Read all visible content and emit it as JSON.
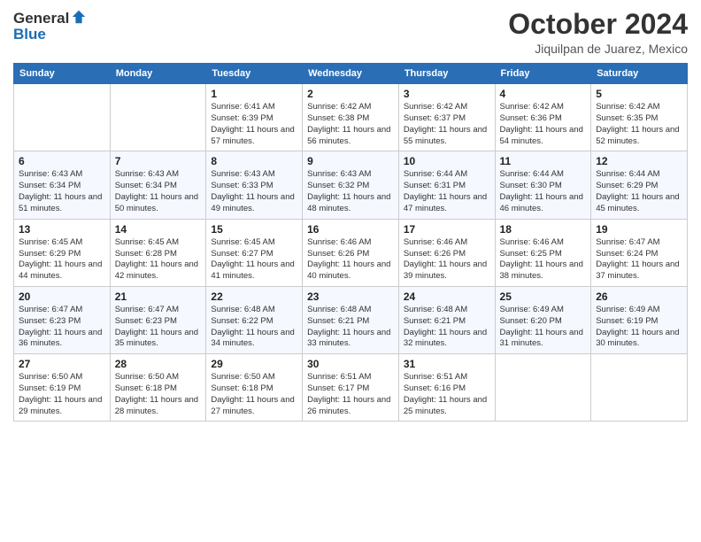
{
  "header": {
    "logo_general": "General",
    "logo_blue": "Blue",
    "title": "October 2024",
    "location": "Jiquilpan de Juarez, Mexico"
  },
  "days_of_week": [
    "Sunday",
    "Monday",
    "Tuesday",
    "Wednesday",
    "Thursday",
    "Friday",
    "Saturday"
  ],
  "weeks": [
    [
      {
        "day": "",
        "sunrise": "",
        "sunset": "",
        "daylight": ""
      },
      {
        "day": "",
        "sunrise": "",
        "sunset": "",
        "daylight": ""
      },
      {
        "day": "1",
        "sunrise": "Sunrise: 6:41 AM",
        "sunset": "Sunset: 6:39 PM",
        "daylight": "Daylight: 11 hours and 57 minutes."
      },
      {
        "day": "2",
        "sunrise": "Sunrise: 6:42 AM",
        "sunset": "Sunset: 6:38 PM",
        "daylight": "Daylight: 11 hours and 56 minutes."
      },
      {
        "day": "3",
        "sunrise": "Sunrise: 6:42 AM",
        "sunset": "Sunset: 6:37 PM",
        "daylight": "Daylight: 11 hours and 55 minutes."
      },
      {
        "day": "4",
        "sunrise": "Sunrise: 6:42 AM",
        "sunset": "Sunset: 6:36 PM",
        "daylight": "Daylight: 11 hours and 54 minutes."
      },
      {
        "day": "5",
        "sunrise": "Sunrise: 6:42 AM",
        "sunset": "Sunset: 6:35 PM",
        "daylight": "Daylight: 11 hours and 52 minutes."
      }
    ],
    [
      {
        "day": "6",
        "sunrise": "Sunrise: 6:43 AM",
        "sunset": "Sunset: 6:34 PM",
        "daylight": "Daylight: 11 hours and 51 minutes."
      },
      {
        "day": "7",
        "sunrise": "Sunrise: 6:43 AM",
        "sunset": "Sunset: 6:34 PM",
        "daylight": "Daylight: 11 hours and 50 minutes."
      },
      {
        "day": "8",
        "sunrise": "Sunrise: 6:43 AM",
        "sunset": "Sunset: 6:33 PM",
        "daylight": "Daylight: 11 hours and 49 minutes."
      },
      {
        "day": "9",
        "sunrise": "Sunrise: 6:43 AM",
        "sunset": "Sunset: 6:32 PM",
        "daylight": "Daylight: 11 hours and 48 minutes."
      },
      {
        "day": "10",
        "sunrise": "Sunrise: 6:44 AM",
        "sunset": "Sunset: 6:31 PM",
        "daylight": "Daylight: 11 hours and 47 minutes."
      },
      {
        "day": "11",
        "sunrise": "Sunrise: 6:44 AM",
        "sunset": "Sunset: 6:30 PM",
        "daylight": "Daylight: 11 hours and 46 minutes."
      },
      {
        "day": "12",
        "sunrise": "Sunrise: 6:44 AM",
        "sunset": "Sunset: 6:29 PM",
        "daylight": "Daylight: 11 hours and 45 minutes."
      }
    ],
    [
      {
        "day": "13",
        "sunrise": "Sunrise: 6:45 AM",
        "sunset": "Sunset: 6:29 PM",
        "daylight": "Daylight: 11 hours and 44 minutes."
      },
      {
        "day": "14",
        "sunrise": "Sunrise: 6:45 AM",
        "sunset": "Sunset: 6:28 PM",
        "daylight": "Daylight: 11 hours and 42 minutes."
      },
      {
        "day": "15",
        "sunrise": "Sunrise: 6:45 AM",
        "sunset": "Sunset: 6:27 PM",
        "daylight": "Daylight: 11 hours and 41 minutes."
      },
      {
        "day": "16",
        "sunrise": "Sunrise: 6:46 AM",
        "sunset": "Sunset: 6:26 PM",
        "daylight": "Daylight: 11 hours and 40 minutes."
      },
      {
        "day": "17",
        "sunrise": "Sunrise: 6:46 AM",
        "sunset": "Sunset: 6:26 PM",
        "daylight": "Daylight: 11 hours and 39 minutes."
      },
      {
        "day": "18",
        "sunrise": "Sunrise: 6:46 AM",
        "sunset": "Sunset: 6:25 PM",
        "daylight": "Daylight: 11 hours and 38 minutes."
      },
      {
        "day": "19",
        "sunrise": "Sunrise: 6:47 AM",
        "sunset": "Sunset: 6:24 PM",
        "daylight": "Daylight: 11 hours and 37 minutes."
      }
    ],
    [
      {
        "day": "20",
        "sunrise": "Sunrise: 6:47 AM",
        "sunset": "Sunset: 6:23 PM",
        "daylight": "Daylight: 11 hours and 36 minutes."
      },
      {
        "day": "21",
        "sunrise": "Sunrise: 6:47 AM",
        "sunset": "Sunset: 6:23 PM",
        "daylight": "Daylight: 11 hours and 35 minutes."
      },
      {
        "day": "22",
        "sunrise": "Sunrise: 6:48 AM",
        "sunset": "Sunset: 6:22 PM",
        "daylight": "Daylight: 11 hours and 34 minutes."
      },
      {
        "day": "23",
        "sunrise": "Sunrise: 6:48 AM",
        "sunset": "Sunset: 6:21 PM",
        "daylight": "Daylight: 11 hours and 33 minutes."
      },
      {
        "day": "24",
        "sunrise": "Sunrise: 6:48 AM",
        "sunset": "Sunset: 6:21 PM",
        "daylight": "Daylight: 11 hours and 32 minutes."
      },
      {
        "day": "25",
        "sunrise": "Sunrise: 6:49 AM",
        "sunset": "Sunset: 6:20 PM",
        "daylight": "Daylight: 11 hours and 31 minutes."
      },
      {
        "day": "26",
        "sunrise": "Sunrise: 6:49 AM",
        "sunset": "Sunset: 6:19 PM",
        "daylight": "Daylight: 11 hours and 30 minutes."
      }
    ],
    [
      {
        "day": "27",
        "sunrise": "Sunrise: 6:50 AM",
        "sunset": "Sunset: 6:19 PM",
        "daylight": "Daylight: 11 hours and 29 minutes."
      },
      {
        "day": "28",
        "sunrise": "Sunrise: 6:50 AM",
        "sunset": "Sunset: 6:18 PM",
        "daylight": "Daylight: 11 hours and 28 minutes."
      },
      {
        "day": "29",
        "sunrise": "Sunrise: 6:50 AM",
        "sunset": "Sunset: 6:18 PM",
        "daylight": "Daylight: 11 hours and 27 minutes."
      },
      {
        "day": "30",
        "sunrise": "Sunrise: 6:51 AM",
        "sunset": "Sunset: 6:17 PM",
        "daylight": "Daylight: 11 hours and 26 minutes."
      },
      {
        "day": "31",
        "sunrise": "Sunrise: 6:51 AM",
        "sunset": "Sunset: 6:16 PM",
        "daylight": "Daylight: 11 hours and 25 minutes."
      },
      {
        "day": "",
        "sunrise": "",
        "sunset": "",
        "daylight": ""
      },
      {
        "day": "",
        "sunrise": "",
        "sunset": "",
        "daylight": ""
      }
    ]
  ]
}
